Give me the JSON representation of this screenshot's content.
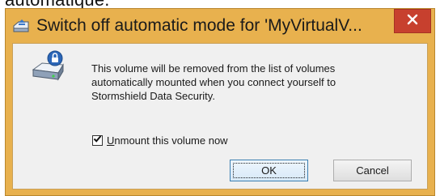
{
  "background": {
    "fragment_text": "automatique."
  },
  "dialog": {
    "title": "Switch off automatic mode for 'MyVirtualV...",
    "close_glyph": "✕",
    "message_lines": [
      "This volume will be removed from the list of volumes",
      "automatically mounted when you connect yourself to",
      "Stormshield Data Security."
    ],
    "checkbox": {
      "label_underlined_char": "U",
      "label_rest": "nmount this volume now",
      "checked": true
    },
    "buttons": {
      "ok_label": "OK",
      "cancel_label": "Cancel"
    }
  },
  "colors": {
    "frame": "#e8b14e",
    "close_button": "#c7402e",
    "client_area": "#f0f0f0",
    "lock_badge": "#2b66b8"
  },
  "icons": {
    "title": "volume-eject-icon",
    "main": "locked-disk-icon",
    "close": "close-icon",
    "checkmark": "checkmark-icon"
  }
}
